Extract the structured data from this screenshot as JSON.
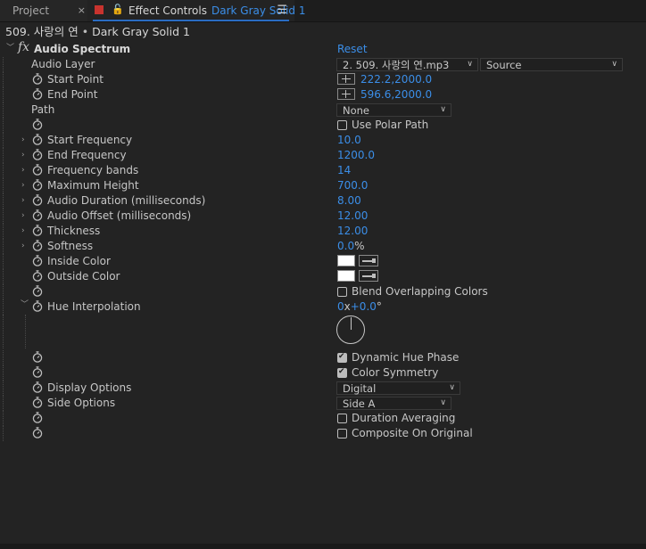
{
  "tabs": {
    "project_label": "Project",
    "close_glyph": "×",
    "lock_glyph": "🔓",
    "effect_controls_label": "Effect Controls",
    "layer_name": "Dark Gray Solid 1",
    "menu_glyph": "☰"
  },
  "subheader": {
    "comp": "509. 사랑의 연",
    "separator": " • ",
    "layer": "Dark Gray Solid 1"
  },
  "effect": {
    "fx_glyph": "fx",
    "name": "Audio Spectrum",
    "reset_label": "Reset"
  },
  "props": {
    "audio_layer": {
      "label": "Audio Layer",
      "value": "2. 509. 사랑의 연.mp3",
      "source": "Source"
    },
    "start_point": {
      "label": "Start Point",
      "value": "222.2,2000.0"
    },
    "end_point": {
      "label": "End Point",
      "value": "596.6,2000.0"
    },
    "path": {
      "label": "Path",
      "value": "None"
    },
    "use_polar_path": {
      "label": "Use Polar Path",
      "checked": false
    },
    "start_frequency": {
      "label": "Start Frequency",
      "value": "10.0"
    },
    "end_frequency": {
      "label": "End Frequency",
      "value": "1200.0"
    },
    "frequency_bands": {
      "label": "Frequency bands",
      "value": "14"
    },
    "maximum_height": {
      "label": "Maximum Height",
      "value": "700.0"
    },
    "audio_duration": {
      "label": "Audio Duration (milliseconds)",
      "value": "8.00"
    },
    "audio_offset": {
      "label": "Audio Offset (milliseconds)",
      "value": "12.00"
    },
    "thickness": {
      "label": "Thickness",
      "value": "12.00"
    },
    "softness": {
      "label": "Softness",
      "value": "0.0",
      "unit": "%"
    },
    "inside_color": {
      "label": "Inside Color",
      "color": "#ffffff"
    },
    "outside_color": {
      "label": "Outside Color",
      "color": "#ffffff"
    },
    "blend_overlapping": {
      "label": "Blend Overlapping Colors",
      "checked": false
    },
    "hue_interpolation": {
      "label": "Hue Interpolation",
      "revolutions": "0",
      "x": "x",
      "degrees": "+0.0",
      "degree_sign": "°"
    },
    "dynamic_hue_phase": {
      "label": "Dynamic Hue Phase",
      "checked": true
    },
    "color_symmetry": {
      "label": "Color Symmetry",
      "checked": true
    },
    "display_options": {
      "label": "Display Options",
      "value": "Digital"
    },
    "side_options": {
      "label": "Side Options",
      "value": "Side A"
    },
    "duration_averaging": {
      "label": "Duration Averaging",
      "checked": false
    },
    "composite_on_original": {
      "label": "Composite On Original",
      "checked": false
    }
  },
  "colors": {
    "accent_blue": "#3b8ee8",
    "label_square_red": "#c8332e",
    "panel_bg": "#232323"
  }
}
